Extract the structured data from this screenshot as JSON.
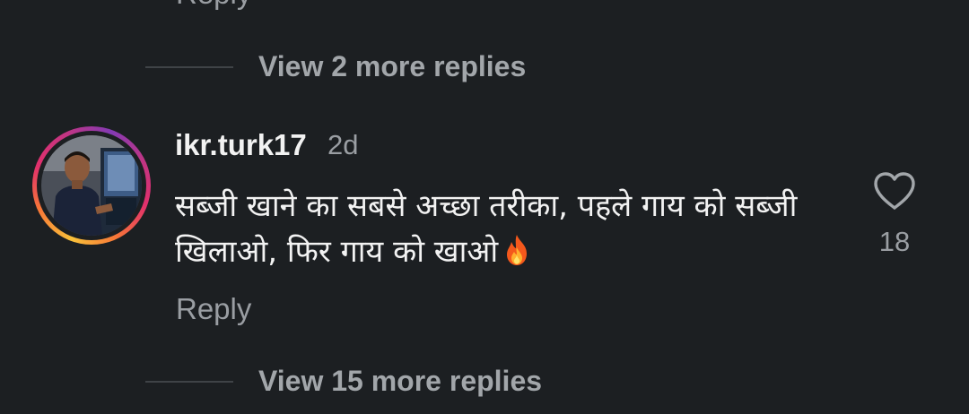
{
  "previous_comment": {
    "reply_label": "Reply"
  },
  "view_replies_top": {
    "label": "View 2 more replies"
  },
  "comment": {
    "username": "ikr.turk17",
    "time": "2d",
    "text": "सब्जी खाने का सबसे अच्छा तरीका, पहले गाय को सब्जी खिलाओ, फिर गाय को खाओ",
    "emoji": "fire-emoji",
    "reply_label": "Reply",
    "like_count": "18",
    "like_icon": "heart-outline-icon",
    "avatar_ring_colors": [
      "#f9c13a",
      "#f77737",
      "#e1306c",
      "#c13584",
      "#833ab4"
    ]
  },
  "view_replies_bottom": {
    "label": "View 15 more replies"
  },
  "theme": {
    "background": "#1c1f22",
    "primary_text": "#f2f2f2",
    "secondary_text": "#9a9ea3"
  }
}
